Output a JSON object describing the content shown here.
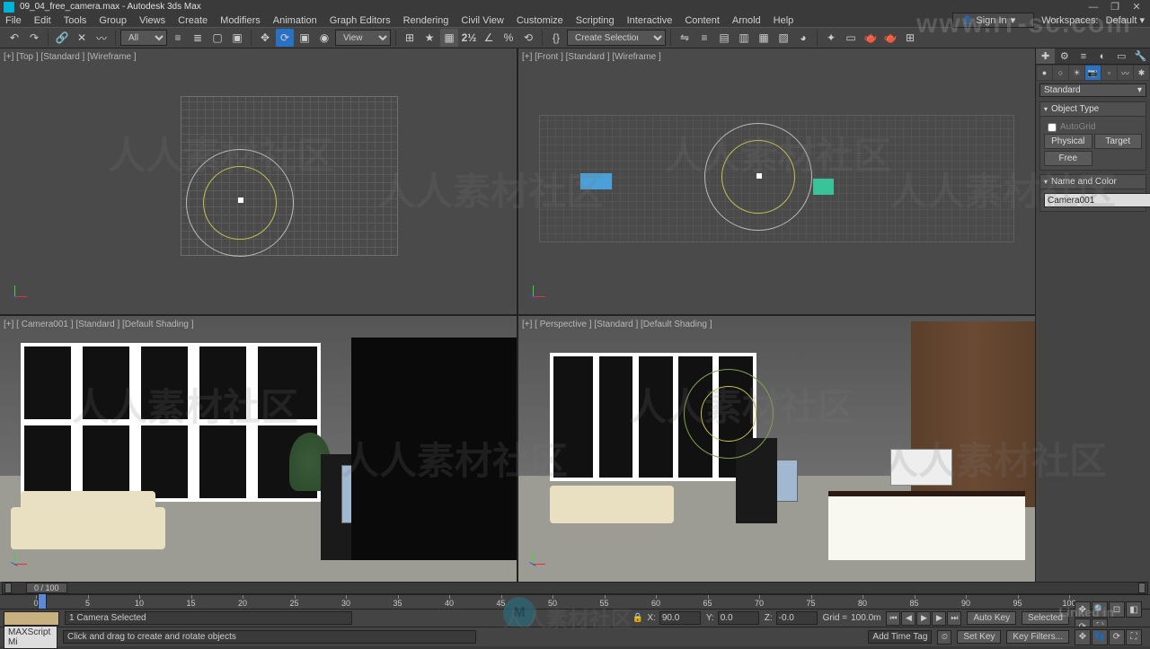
{
  "app": {
    "title": "09_04_free_camera.max - Autodesk 3ds Max"
  },
  "window_buttons": {
    "min": "—",
    "max": "❐",
    "close": "✕"
  },
  "menu": [
    "File",
    "Edit",
    "Tools",
    "Group",
    "Views",
    "Create",
    "Modifiers",
    "Animation",
    "Graph Editors",
    "Rendering",
    "Civil View",
    "Customize",
    "Scripting",
    "Interactive",
    "Content",
    "Arnold",
    "Help"
  ],
  "menu_right": {
    "signin": "Sign In",
    "workspaces_label": "Workspaces:",
    "workspace": "Default"
  },
  "toolbar": {
    "selset_all": "All",
    "refcoord": "View",
    "named_sel": "Create Selection Se"
  },
  "viewports": {
    "top": "[+] [Top ] [Standard ] [Wireframe ]",
    "front": "[+] [Front ] [Standard ] [Wireframe ]",
    "camera": "[+] [ Camera001 ] [Standard ] [Default Shading ]",
    "persp": "[+] [ Perspective ] [Standard ] [Default Shading ]"
  },
  "cmdpanel": {
    "category": "Standard",
    "rollout_objtype": "Object Type",
    "autogrid": "AutoGrid",
    "btn_physical": "Physical",
    "btn_target": "Target",
    "btn_free": "Free",
    "rollout_namecolor": "Name and Color",
    "obj_name": "Camera001"
  },
  "timeline": {
    "range": "0 / 100",
    "ticks": [
      "0",
      "5",
      "10",
      "15",
      "20",
      "25",
      "30",
      "35",
      "40",
      "45",
      "50",
      "55",
      "60",
      "65",
      "70",
      "75",
      "80",
      "85",
      "90",
      "95",
      "100"
    ]
  },
  "status": {
    "selected": "1 Camera Selected",
    "prompt": "Click and drag to create and rotate objects",
    "maxscript": "MAXScript Mi",
    "x_label": "X:",
    "x_val": "90.0",
    "y_label": "Y:",
    "y_val": "0.0",
    "z_label": "Z:",
    "z_val": "-0.0",
    "grid_label": "Grid =",
    "grid_val": "100.0m",
    "add_time_tag": "Add Time Tag",
    "autokey": "Auto Key",
    "setkey_label": "Selected",
    "setkey": "Set Key",
    "keyfilters": "Key Filters..."
  },
  "watermark_text": "人人素材社区",
  "watermark_url": "www.rr-sc.com",
  "linkedin": "Linked in"
}
